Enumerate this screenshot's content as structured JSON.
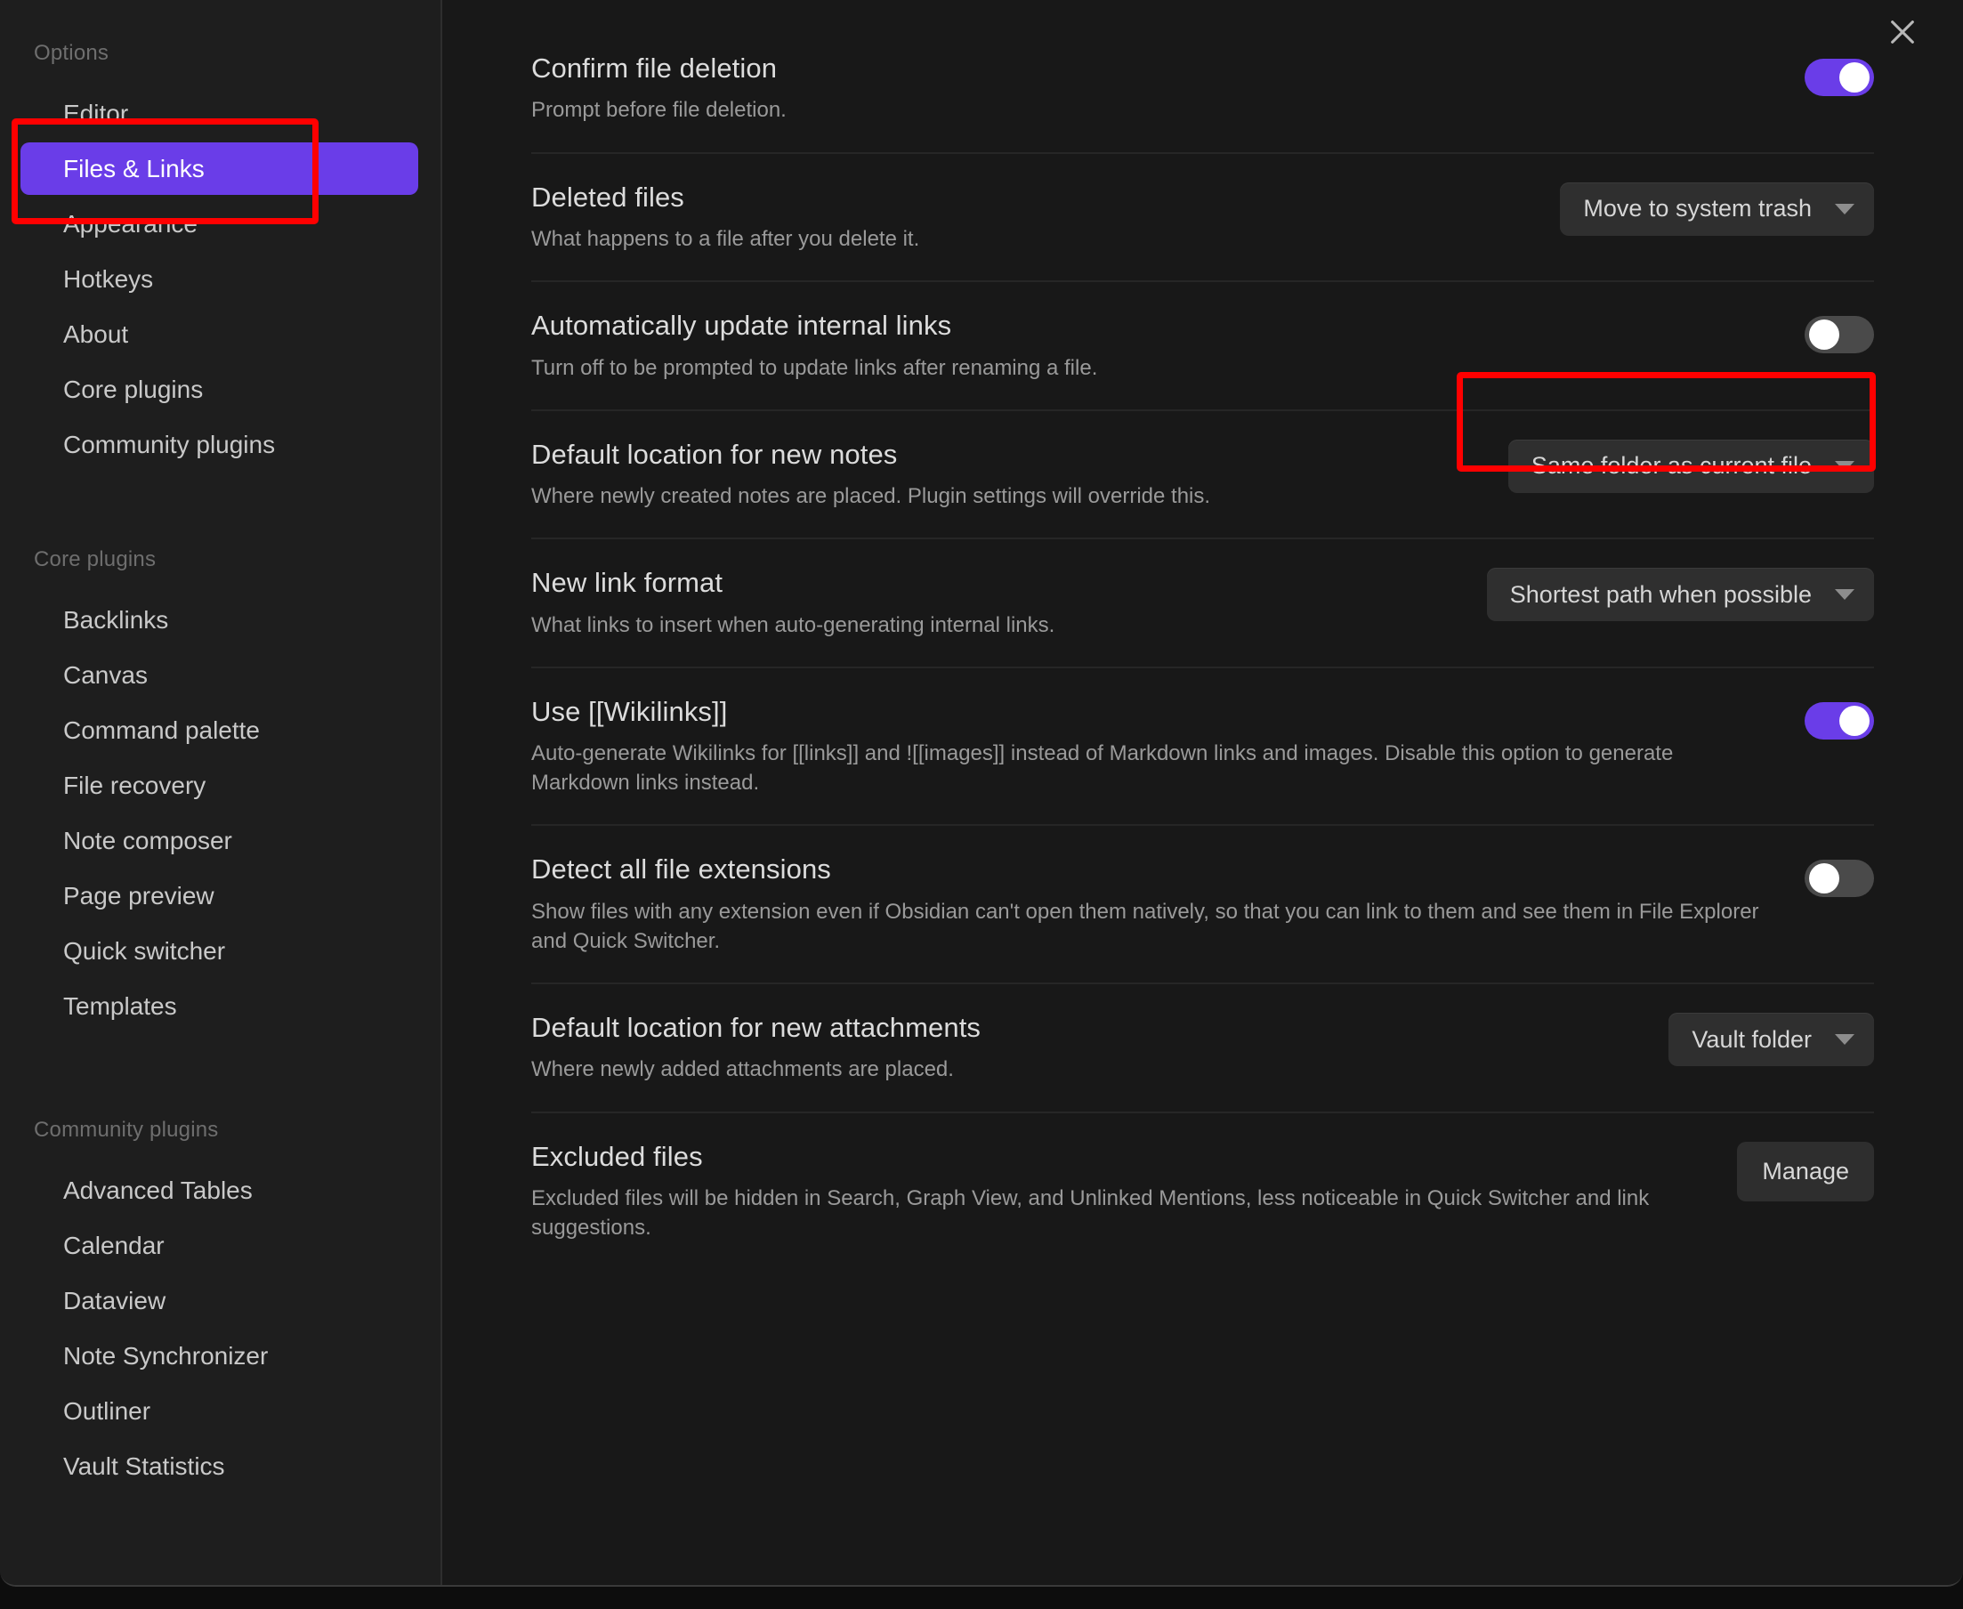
{
  "window": {
    "close_icon": "close-icon"
  },
  "sidebar": {
    "groups": [
      {
        "heading": "Options",
        "items": [
          {
            "label": "Editor",
            "active": false
          },
          {
            "label": "Files & Links",
            "active": true
          },
          {
            "label": "Appearance",
            "active": false
          },
          {
            "label": "Hotkeys",
            "active": false
          },
          {
            "label": "About",
            "active": false
          },
          {
            "label": "Core plugins",
            "active": false
          },
          {
            "label": "Community plugins",
            "active": false
          }
        ]
      },
      {
        "heading": "Core plugins",
        "items": [
          {
            "label": "Backlinks",
            "active": false
          },
          {
            "label": "Canvas",
            "active": false
          },
          {
            "label": "Command palette",
            "active": false
          },
          {
            "label": "File recovery",
            "active": false
          },
          {
            "label": "Note composer",
            "active": false
          },
          {
            "label": "Page preview",
            "active": false
          },
          {
            "label": "Quick switcher",
            "active": false
          },
          {
            "label": "Templates",
            "active": false
          }
        ]
      },
      {
        "heading": "Community plugins",
        "items": [
          {
            "label": "Advanced Tables",
            "active": false
          },
          {
            "label": "Calendar",
            "active": false
          },
          {
            "label": "Dataview",
            "active": false
          },
          {
            "label": "Note Synchronizer",
            "active": false
          },
          {
            "label": "Outliner",
            "active": false
          },
          {
            "label": "Vault Statistics",
            "active": false
          }
        ]
      }
    ]
  },
  "settings": [
    {
      "name": "Confirm file deletion",
      "desc": "Prompt before file deletion.",
      "control": "toggle",
      "value": "on"
    },
    {
      "name": "Deleted files",
      "desc": "What happens to a file after you delete it.",
      "control": "dropdown",
      "value": "Move to system trash"
    },
    {
      "name": "Automatically update internal links",
      "desc": "Turn off to be prompted to update links after renaming a file.",
      "control": "toggle",
      "value": "off"
    },
    {
      "name": "Default location for new notes",
      "desc": "Where newly created notes are placed. Plugin settings will override this.",
      "control": "dropdown",
      "value": "Same folder as current file"
    },
    {
      "name": "New link format",
      "desc": "What links to insert when auto-generating internal links.",
      "control": "dropdown",
      "value": "Shortest path when possible"
    },
    {
      "name": "Use [[Wikilinks]]",
      "desc": "Auto-generate Wikilinks for [[links]] and ![[images]] instead of Markdown links and images. Disable this option to generate Markdown links instead.",
      "control": "toggle",
      "value": "on"
    },
    {
      "name": "Detect all file extensions",
      "desc": "Show files with any extension even if Obsidian can't open them natively, so that you can link to them and see them in File Explorer and Quick Switcher.",
      "control": "toggle",
      "value": "off"
    },
    {
      "name": "Default location for new attachments",
      "desc": "Where newly added attachments are placed.",
      "control": "dropdown",
      "value": "Vault folder"
    },
    {
      "name": "Excluded files",
      "desc": "Excluded files will be hidden in Search, Graph View, and Unlinked Mentions, less noticeable in Quick Switcher and link suggestions.",
      "control": "button",
      "value": "Manage"
    }
  ],
  "annotations": {
    "accent_color": "#6a3de8",
    "highlight_color": "#ff0000",
    "sidebar_box_targets": "Files & Links / Appearance",
    "dropdown_box_target": "Same folder as current file"
  }
}
